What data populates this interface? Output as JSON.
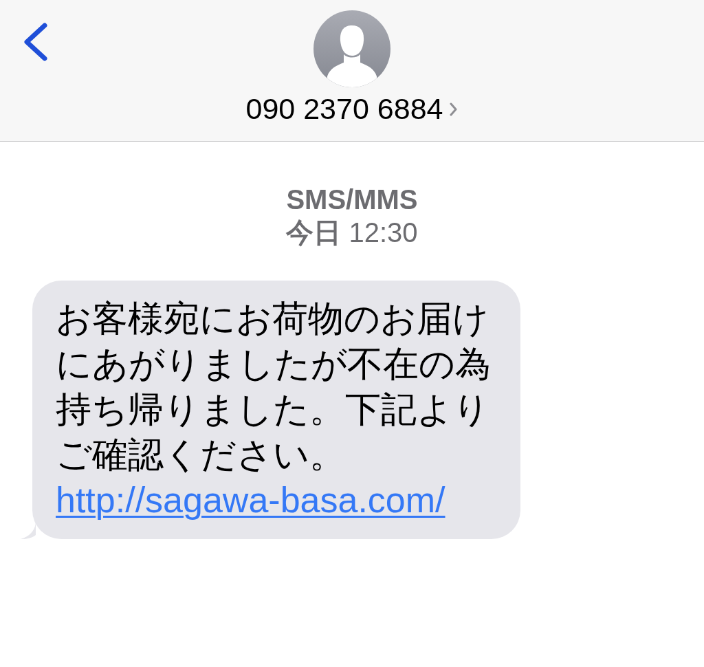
{
  "contact": {
    "phone": "090 2370 6884"
  },
  "thread": {
    "service": "SMS/MMS",
    "timestamp": "**今日** 12:30"
  },
  "messages": [
    {
      "kind": "received",
      "text": "お客様宛にお荷物のお届けにあがりましたが不在の為持ち帰りました。下記よりご確認ください。",
      "link": "http://sagawa-basa.com/"
    }
  ]
}
